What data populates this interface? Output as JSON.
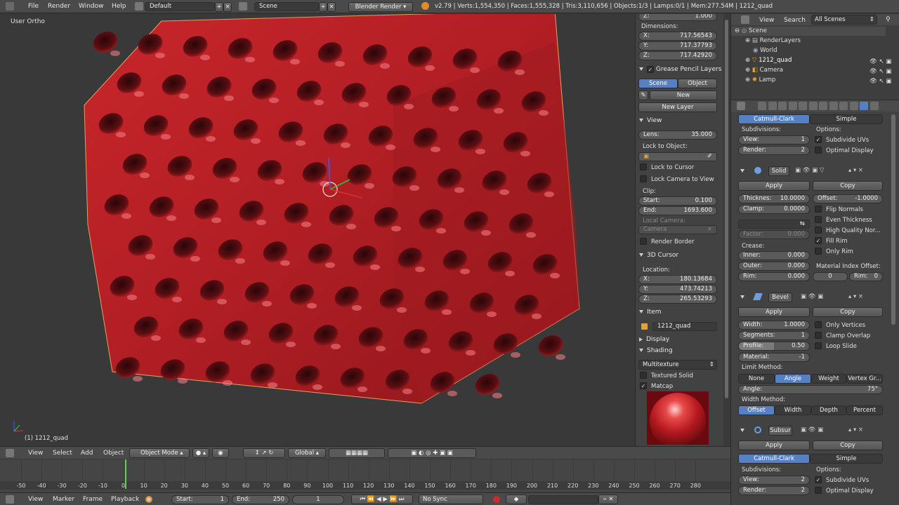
{
  "topbar": {
    "menus": [
      "File",
      "Render",
      "Window",
      "Help"
    ],
    "layout": "Default",
    "scene": "Scene",
    "engine": "Blender Render",
    "stats": "v2.79 | Verts:1,554,350 | Faces:1,555,328 | Tris:3,110,656 | Objects:1/3 | Lamps:0/1 | Mem:277.54M | 1212_quad"
  },
  "viewport": {
    "view_label": "User Ortho",
    "object_label": "(1) 1212_quad"
  },
  "viewport_header": {
    "menus": [
      "View",
      "Select",
      "Add",
      "Object"
    ],
    "mode": "Object Mode",
    "orientation": "Global"
  },
  "npanel": {
    "z_top": {
      "label": "Z:",
      "value": "1.000"
    },
    "dimensions_title": "Dimensions:",
    "dims": [
      {
        "l": "X:",
        "v": "717.56543"
      },
      {
        "l": "Y:",
        "v": "717.37793"
      },
      {
        "l": "Z:",
        "v": "717.42920"
      }
    ],
    "grease_title": "Grease Pencil Layers",
    "gp_scene": "Scene",
    "gp_object": "Object",
    "gp_new": "New",
    "gp_new_layer": "New Layer",
    "view_title": "View",
    "lens_label": "Lens:",
    "lens_value": "35.000",
    "lock_object": "Lock to Object:",
    "lock_cursor": "Lock to Cursor",
    "lock_camera": "Lock Camera to View",
    "clip": "Clip:",
    "clip_start_label": "Start:",
    "clip_start": "0.100",
    "clip_end_label": "End:",
    "clip_end": "1693.600",
    "local_camera": "Local Camera:",
    "camera_field": "Camera",
    "render_border": "Render Border",
    "cursor_title": "3D Cursor",
    "location": "Location:",
    "cursor": [
      {
        "l": "X:",
        "v": "180.13684"
      },
      {
        "l": "Y:",
        "v": "473.74213"
      },
      {
        "l": "Z:",
        "v": "265.53293"
      }
    ],
    "item_title": "Item",
    "item_name": "1212_quad",
    "display_title": "Display",
    "shading_title": "Shading",
    "shading_mode": "Multitexture",
    "textured_solid": "Textured Solid",
    "matcap": "Matcap"
  },
  "outliner": {
    "menus": [
      "View",
      "Search"
    ],
    "scope": "All Scenes",
    "items": [
      "Scene",
      "RenderLayers",
      "World",
      "1212_quad",
      "Camera",
      "Lamp"
    ]
  },
  "props": {
    "subsurf1": {
      "catmull": "Catmull-Clark",
      "simple": "Simple",
      "subdivisions": "Subdivisions:",
      "options": "Options:",
      "view_label": "View:",
      "view_val": "1",
      "render_label": "Render:",
      "render_val": "2",
      "subdivide_uvs": "Subdivide UVs",
      "optimal_display": "Optimal Display"
    },
    "solid": {
      "name": "Solid",
      "apply": "Apply",
      "copy": "Copy",
      "thick_label": "Thicknes:",
      "thick_val": "10.0000",
      "offset_label": "Offset:",
      "offset_val": "-1.0000",
      "clamp_label": "Clamp:",
      "clamp_val": "0.0000",
      "flip": "Flip Normals",
      "even": "Even Thickness",
      "hq": "High Quality Nor...",
      "fill_rim": "Fill Rim",
      "only_rim": "Only Rim",
      "factor_label": "Factor:",
      "factor_val": "0.000",
      "crease": "Crease:",
      "inner_label": "Inner:",
      "inner_val": "0.000",
      "outer_label": "Outer:",
      "outer_val": "0.000",
      "rim_label": "Rim:",
      "rim_val": "0.000",
      "mat_offset": "Material Index Offset:",
      "mat_val": "0",
      "rim2_label": "Rim:",
      "rim2_val": "0"
    },
    "bevel": {
      "name": "Bevel",
      "apply": "Apply",
      "copy": "Copy",
      "width_label": "Width:",
      "width_val": "1.0000",
      "seg_label": "Segments:",
      "seg_val": "1",
      "profile_label": "Profile:",
      "profile_val": "0.50",
      "mat_label": "Material:",
      "mat_val": "-1",
      "only_vertices": "Only Vertices",
      "clamp_overlap": "Clamp Overlap",
      "loop_slide": "Loop Slide",
      "limit": "Limit Method:",
      "limits": [
        "None",
        "Angle",
        "Weight",
        "Vertex Gr..."
      ],
      "angle_label": "Angle:",
      "angle_val": "75°",
      "width_method": "Width Method:",
      "wmethods": [
        "Offset",
        "Width",
        "Depth",
        "Percent"
      ]
    },
    "subsurf2": {
      "name": "Subsur",
      "apply": "Apply",
      "copy": "Copy",
      "catmull": "Catmull-Clark",
      "simple": "Simple",
      "subdivisions": "Subdivisions:",
      "options": "Options:",
      "view_label": "View:",
      "view_val": "2",
      "render_label": "Render:",
      "render_val": "2",
      "subdivide_uvs": "Subdivide UVs",
      "optimal_display": "Optimal Display"
    }
  },
  "timeline": {
    "ticks": [
      "-50",
      "-40",
      "-30",
      "-20",
      "-10",
      "0",
      "10",
      "20",
      "30",
      "40",
      "50",
      "60",
      "70",
      "80",
      "90",
      "100",
      "110",
      "120",
      "130",
      "140",
      "150",
      "160",
      "170",
      "180",
      "190",
      "200",
      "210",
      "220",
      "230",
      "240",
      "250",
      "260",
      "270",
      "280"
    ],
    "menus": [
      "View",
      "Marker",
      "Frame",
      "Playback"
    ],
    "start_label": "Start:",
    "start_val": "1",
    "end_label": "End:",
    "end_val": "250",
    "current": "1",
    "sync": "No Sync"
  }
}
